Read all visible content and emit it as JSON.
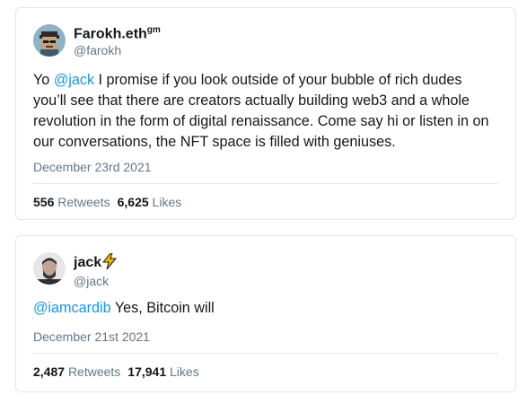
{
  "tweets": [
    {
      "display_name": "Farokh.eth",
      "name_suffix": "gm",
      "handle": "@farokh",
      "text_parts": [
        {
          "text": "Yo ",
          "type": "plain"
        },
        {
          "text": "@jack",
          "type": "mention"
        },
        {
          "text": " I promise if you look outside of your bubble of rich dudes you’ll see that there are creators actually building web3 and a whole revolution in the form of digital renaissance. Come say hi or listen in on our conversations, the NFT space is filled with geniuses.",
          "type": "plain"
        }
      ],
      "date": "December 23rd 2021",
      "retweets": "556",
      "retweets_label": "Retweets",
      "likes": "6,625",
      "likes_label": "Likes"
    },
    {
      "display_name": "jack",
      "name_suffix": "⚡",
      "handle": "@jack",
      "text_parts": [
        {
          "text": "@iamcardib",
          "type": "mention"
        },
        {
          "text": " Yes, Bitcoin will",
          "type": "plain"
        }
      ],
      "date": "December 21st 2021",
      "retweets": "2,487",
      "retweets_label": "Retweets",
      "likes": "17,941",
      "likes_label": "Likes"
    }
  ],
  "colors": {
    "mention": "#1b95e0",
    "secondary_text": "#657786",
    "border": "#e1e8ed",
    "lightning": "#f5b400"
  },
  "icons": {
    "avatar_1": "pixel-art-avatar",
    "avatar_2": "profile-photo-avatar"
  }
}
